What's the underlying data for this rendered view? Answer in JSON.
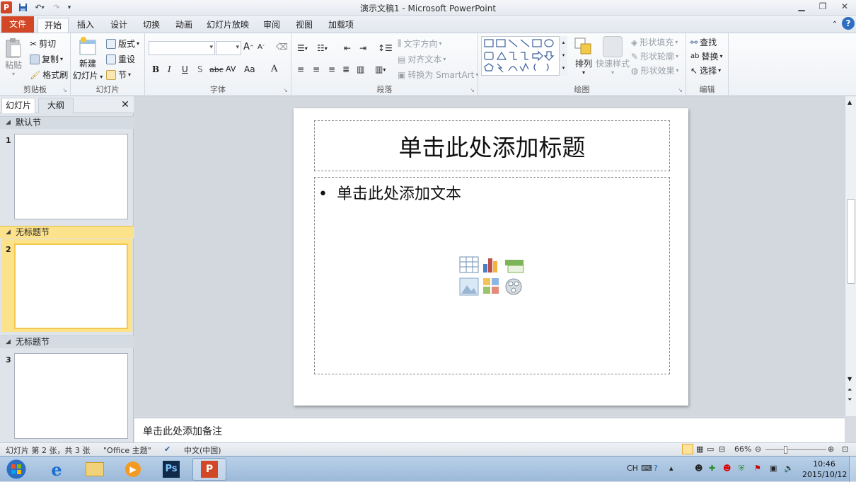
{
  "window": {
    "title": "演示文稿1 - Microsoft PowerPoint"
  },
  "tabs": [
    "文件",
    "开始",
    "插入",
    "设计",
    "切换",
    "动画",
    "幻灯片放映",
    "审阅",
    "视图",
    "加载项"
  ],
  "ribbon": {
    "clipboard": {
      "paste": "粘贴",
      "cut": "剪切",
      "copy": "复制",
      "format_painter": "格式刷",
      "label": "剪贴板"
    },
    "slides": {
      "new_slide": "新建",
      "new_slide2": "幻灯片",
      "layout": "版式",
      "reset": "重设",
      "section": "节",
      "label": "幻灯片"
    },
    "font": {
      "label": "字体",
      "bold": "B",
      "italic": "I",
      "underline": "U",
      "shadow": "S",
      "strike": "abc",
      "spacing": "AV",
      "case": "Aa",
      "color": "A",
      "grow": "A",
      "shrink": "A"
    },
    "paragraph": {
      "text_direction": "文字方向",
      "align_text": "对齐文本",
      "smartart": "转换为 SmartArt",
      "label": "段落"
    },
    "drawing": {
      "arrange": "排列",
      "quick_styles": "快速样式",
      "shape_fill": "形状填充",
      "shape_outline": "形状轮廓",
      "shape_effects": "形状效果",
      "label": "绘图"
    },
    "editing": {
      "find": "查找",
      "replace": "替换",
      "select": "选择",
      "label": "编辑"
    }
  },
  "left_pane": {
    "tab_slides": "幻灯片",
    "tab_outline": "大纲",
    "sections": [
      {
        "name": "默认节",
        "slide": "1"
      },
      {
        "name": "无标题节",
        "slide": "2"
      },
      {
        "name": "无标题节",
        "slide": "3"
      }
    ]
  },
  "slide": {
    "title_placeholder": "单击此处添加标题",
    "body_placeholder": "单击此处添加文本",
    "bullet": "•"
  },
  "notes": {
    "placeholder": "单击此处添加备注"
  },
  "status": {
    "slide_info": "幻灯片 第 2 张，共 3 张",
    "theme": "\"Office 主题\"",
    "language": "中文(中国)",
    "zoom": "66%"
  },
  "taskbar": {
    "time": "10:46",
    "date": "2015/10/12",
    "ime": "CH"
  },
  "colors": {
    "file_tab": "#d24726",
    "selected_section": "#fce28a",
    "selected_thumb_border": "#f2c94c"
  }
}
